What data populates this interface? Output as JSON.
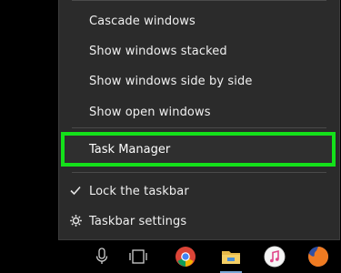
{
  "menu": {
    "items": [
      {
        "label": "Cascade windows"
      },
      {
        "label": "Show windows stacked"
      },
      {
        "label": "Show windows side by side"
      },
      {
        "label": "Show open windows"
      }
    ],
    "task_manager": {
      "label": "Task Manager",
      "highlight_color": "#14e11a"
    },
    "lock_taskbar": {
      "label": "Lock the taskbar",
      "icon": "checkmark-icon",
      "checked": true
    },
    "taskbar_settings": {
      "label": "Taskbar settings",
      "icon": "gear-icon"
    }
  },
  "taskbar": {
    "icons": [
      "microphone-icon",
      "task-view-icon",
      "chrome-icon",
      "file-explorer-icon",
      "itunes-icon",
      "firefox-icon"
    ]
  },
  "colors": {
    "menu_bg": "#2b2b2b",
    "text": "#f0f0f0",
    "taskbar_bg": "#000000",
    "running_indicator": "#7aa7d6"
  }
}
